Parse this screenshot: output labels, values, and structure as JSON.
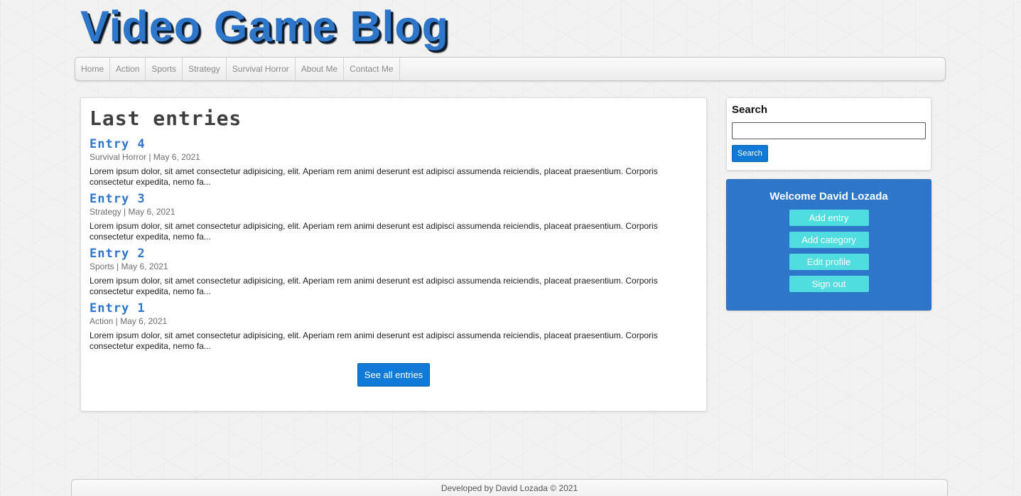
{
  "header": {
    "title": "Video Game Blog"
  },
  "nav": {
    "items": [
      {
        "label": "Home"
      },
      {
        "label": "Action"
      },
      {
        "label": "Sports"
      },
      {
        "label": "Strategy"
      },
      {
        "label": "Survival Horror"
      },
      {
        "label": "About Me"
      },
      {
        "label": "Contact Me"
      }
    ]
  },
  "main": {
    "title": "Last entries",
    "entries": [
      {
        "title": "Entry 4",
        "meta": "Survival Horror | May 6, 2021",
        "excerpt": "Lorem ipsum dolor, sit amet consectetur adipisicing, elit. Aperiam rem animi deserunt est adipisci assumenda reiciendis, placeat praesentium. Corporis consectetur expedita, nemo fa..."
      },
      {
        "title": "Entry 3",
        "meta": "Strategy | May 6, 2021",
        "excerpt": "Lorem ipsum dolor, sit amet consectetur adipisicing, elit. Aperiam rem animi deserunt est adipisci assumenda reiciendis, placeat praesentium. Corporis consectetur expedita, nemo fa..."
      },
      {
        "title": "Entry 2",
        "meta": "Sports | May 6, 2021",
        "excerpt": "Lorem ipsum dolor, sit amet consectetur adipisicing, elit. Aperiam rem animi deserunt est adipisci assumenda reiciendis, placeat praesentium. Corporis consectetur expedita, nemo fa..."
      },
      {
        "title": "Entry 1",
        "meta": "Action | May 6, 2021",
        "excerpt": "Lorem ipsum dolor, sit amet consectetur adipisicing, elit. Aperiam rem animi deserunt est adipisci assumenda reiciendis, placeat praesentium. Corporis consectetur expedita, nemo fa..."
      }
    ],
    "see_all_label": "See all entries"
  },
  "sidebar": {
    "search": {
      "heading": "Search",
      "placeholder": "",
      "value": "",
      "button_label": "Search"
    },
    "user": {
      "welcome": "Welcome David Lozada",
      "actions": [
        {
          "label": "Add entry"
        },
        {
          "label": "Add category"
        },
        {
          "label": "Edit profile"
        },
        {
          "label": "Sign out"
        }
      ]
    }
  },
  "footer": {
    "text": "Developed by David Lozada © 2021"
  },
  "colors": {
    "brand_blue": "#2d76c9",
    "button_blue": "#0f7ad8",
    "action_cyan": "#4fdde0"
  }
}
